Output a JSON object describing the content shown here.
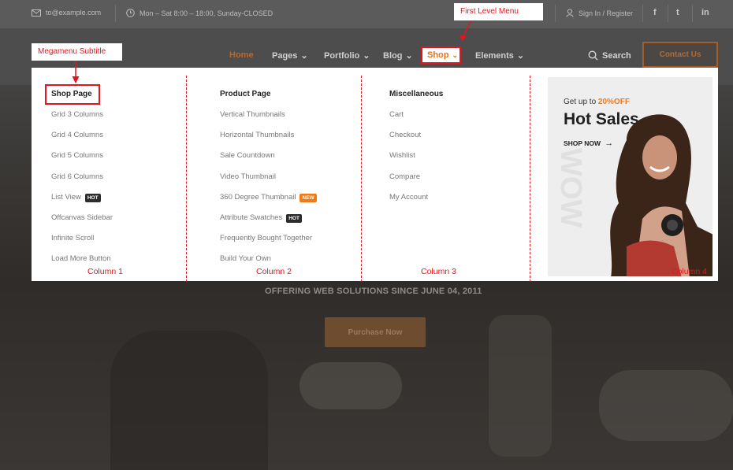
{
  "topbar": {
    "email": "to@example.com",
    "hours": "Mon – Sat 8:00 – 18:00, Sunday-CLOSED",
    "auth": "Sign In / Register",
    "social": [
      "f",
      "t",
      "in"
    ]
  },
  "nav": {
    "items": [
      "Home",
      "Pages",
      "Portfolio",
      "Blog",
      "Shop",
      "Elements"
    ],
    "search_label": "Search",
    "contact_label": "Contact Us"
  },
  "annotations": {
    "first_level_menu": "First Level Menu",
    "megamenu_subtitle": "Megamenu Subtitle",
    "columns": [
      "Column 1",
      "Column 2",
      "Column 3",
      "Column 4"
    ]
  },
  "megamenu": {
    "col1": {
      "title": "Shop Page",
      "items": [
        "Grid 3 Columns",
        "Grid 4 Columns",
        "Grid 5 Columns",
        "Grid 6 Columns",
        "List View",
        "Offcanvas Sidebar",
        "Infinite Scroll",
        "Load More Button"
      ],
      "badges": {
        "list_view": "HOT"
      }
    },
    "col2": {
      "title": "Product Page",
      "items": [
        "Vertical Thumbnails",
        "Horizontal Thumbnails",
        "Sale Countdown",
        "Video Thumbnail",
        "360 Degree Thumbnail",
        "Attribute Swatches",
        "Frequently Bought Together",
        "Build Your Own"
      ],
      "badges": {
        "degree360": "NEW",
        "swatches": "HOT"
      }
    },
    "col3": {
      "title": "Miscellaneous",
      "items": [
        "Cart",
        "Checkout",
        "Wishlist",
        "Compare",
        "My Account"
      ]
    },
    "promo": {
      "pre": "Get up to",
      "discount": "20%OFF",
      "title": "Hot Sales",
      "cta": "SHOP NOW",
      "watermark": "WOW"
    }
  },
  "hero": {
    "tagline": "OFFERING WEB SOLUTIONS SINCE JUNE 04, 2011",
    "button": "Purchase Now"
  },
  "colors": {
    "accent": "#f07a14",
    "annotation": "#e4161d"
  }
}
